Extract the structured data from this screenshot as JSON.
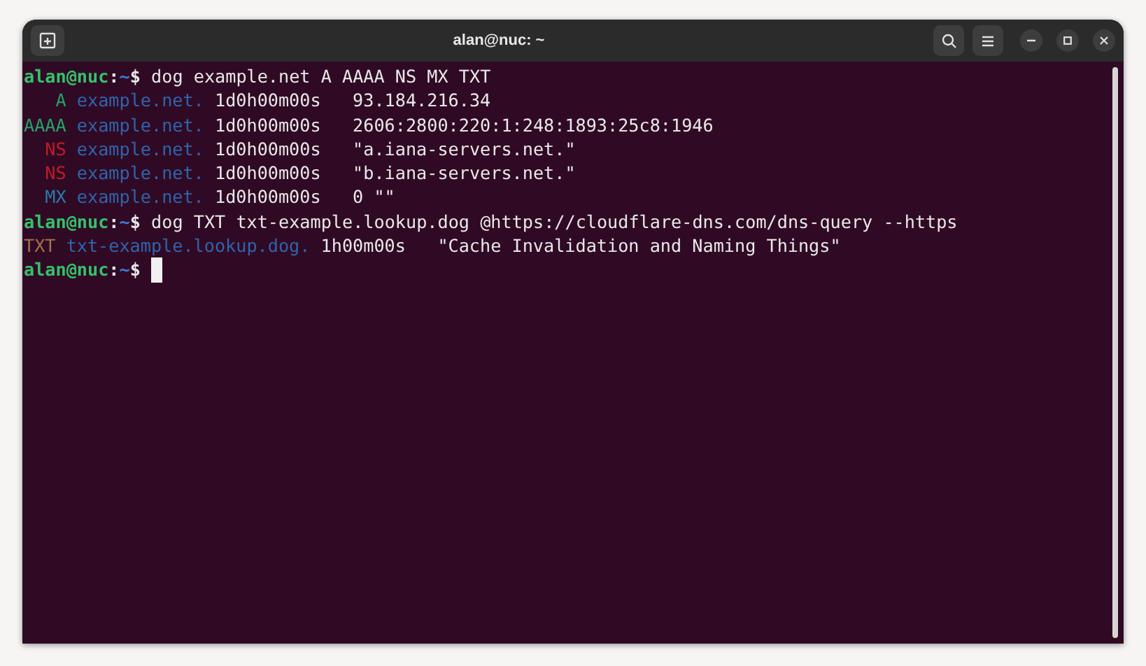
{
  "window": {
    "title": "alan@nuc: ~"
  },
  "terminal": [
    {
      "kind": "prompt",
      "user": "alan@nuc",
      "separator": ":",
      "path": "~",
      "symbol": "$",
      "command": "dog example.net A AAAA NS MX TXT"
    },
    {
      "kind": "records",
      "records": [
        {
          "type": "A",
          "color": "#26a269",
          "name": "example.net.",
          "ttl": "1d0h00m00s",
          "value": "93.184.216.34"
        },
        {
          "type": "AAAA",
          "color": "#26a269",
          "name": "example.net.",
          "ttl": "1d0h00m00s",
          "value": "2606:2800:220:1:248:1893:25c8:1946"
        },
        {
          "type": "NS",
          "color": "#c01c28",
          "name": "example.net.",
          "ttl": "1d0h00m00s",
          "value": "\"a.iana-servers.net.\""
        },
        {
          "type": "NS",
          "color": "#c01c28",
          "name": "example.net.",
          "ttl": "1d0h00m00s",
          "value": "\"b.iana-servers.net.\""
        },
        {
          "type": "MX",
          "color": "#2a7bab",
          "name": "example.net.",
          "ttl": "1d0h00m00s",
          "value": "0 \"\""
        }
      ]
    },
    {
      "kind": "prompt",
      "user": "alan@nuc",
      "separator": ":",
      "path": "~",
      "symbol": "$",
      "command": "dog TXT txt-example.lookup.dog @https://cloudflare-dns.com/dns-query --https"
    },
    {
      "kind": "records",
      "records": [
        {
          "type": "TXT",
          "color": "#a2734c",
          "name": "txt-example.lookup.dog.",
          "ttl": "1h00m00s",
          "value": "\"Cache Invalidation and Naming Things\""
        }
      ]
    },
    {
      "kind": "prompt",
      "user": "alan@nuc",
      "separator": ":",
      "path": "~",
      "symbol": "$",
      "cursor": true
    }
  ]
}
